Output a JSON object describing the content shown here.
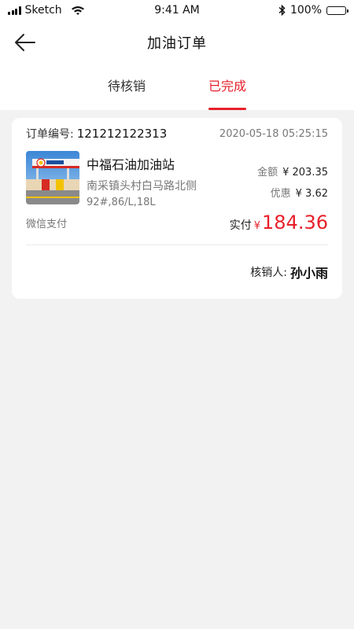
{
  "status_bar": {
    "carrier": "Sketch",
    "time": "9:41 AM",
    "battery": "100%"
  },
  "nav": {
    "title": "加油订单"
  },
  "tabs": [
    {
      "label": "待核销",
      "active": false
    },
    {
      "label": "已完成",
      "active": true
    }
  ],
  "order": {
    "order_no_label": "订单编号:",
    "order_no": "121212122313",
    "time": "2020-05-18 05:25:15",
    "station_name": "中福石油加油站",
    "address": "南采镇头村白马路北侧",
    "fuel_info": "92#,86/L,18L",
    "amount_label": "金额",
    "amount": "¥ 203.35",
    "discount_label": "优惠",
    "discount": "¥ 3.62",
    "pay_method": "微信支付",
    "actual_label": "实付",
    "currency": "¥",
    "actual_amount": "184.36",
    "verifier_label": "核销人:",
    "verifier_name": "孙小雨"
  },
  "colors": {
    "accent": "#e7202a",
    "background": "#f2f2f2"
  },
  "icons": {
    "back": "arrow-left-icon",
    "wifi": "wifi-icon",
    "bluetooth": "bluetooth-icon",
    "battery": "battery-icon"
  }
}
